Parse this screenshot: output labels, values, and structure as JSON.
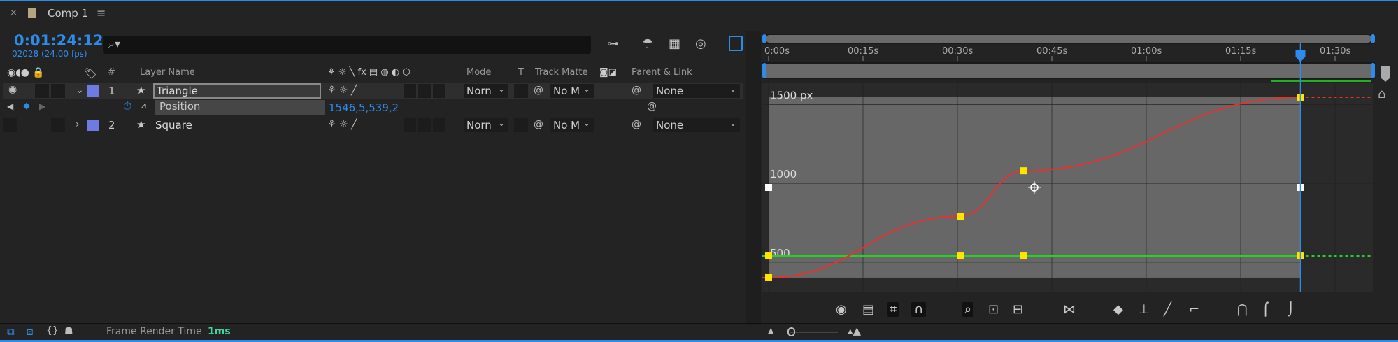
{
  "tab": {
    "close": "×",
    "title": "Comp 1",
    "menu": "≡",
    "swatch_color": "#b8a47e"
  },
  "timecode": {
    "time": "0:01:24:12",
    "frame": "02028 (24.00 fps)"
  },
  "search": {
    "placeholder": "",
    "icon": "⌕▾"
  },
  "columns": {
    "hash": "#",
    "layer_name": "Layer Name",
    "mode": "Mode",
    "t": "T",
    "track_matte": "Track Matte",
    "parent_link": "Parent & Link",
    "switches": "⚘ ☼ ╲ fx ▤ ◍ ◐ ⬡"
  },
  "layers": [
    {
      "num": "1",
      "name": "Triangle",
      "mode": "Norn",
      "matte": "No M",
      "parent": "None",
      "color": "#6d7be3",
      "expanded": true
    },
    {
      "num": "2",
      "name": "Square",
      "mode": "Norn",
      "matte": "No M",
      "parent": "None",
      "color": "#6d7be3",
      "expanded": false
    }
  ],
  "property": {
    "name": "Position",
    "value": "1546,5,539,2"
  },
  "status": {
    "label": "Frame Render Time",
    "value": "1ms"
  },
  "ruler": {
    "ticks": [
      "0:00s",
      "00:15s",
      "00:30s",
      "00:45s",
      "01:00s",
      "01:15s",
      "01:30s"
    ]
  },
  "graph": {
    "value_labels": [
      "1500 px",
      "1000",
      "500"
    ],
    "current_time_s": 84.5,
    "x_series_color": "#e8302e",
    "y_series_color": "#27d127",
    "x_keyframes": [
      {
        "t": 0,
        "v": 402
      },
      {
        "t": 30.5,
        "v": 792
      },
      {
        "t": 40.5,
        "v": 1080
      },
      {
        "t": 84.5,
        "v": 1546.5
      }
    ],
    "y_keyframes": [
      {
        "t": 0,
        "v": 539.2
      },
      {
        "t": 30.5,
        "v": 539.2
      },
      {
        "t": 40.5,
        "v": 539.2
      },
      {
        "t": 84.5,
        "v": 539.2
      }
    ]
  },
  "accent": "#2d8ceb"
}
